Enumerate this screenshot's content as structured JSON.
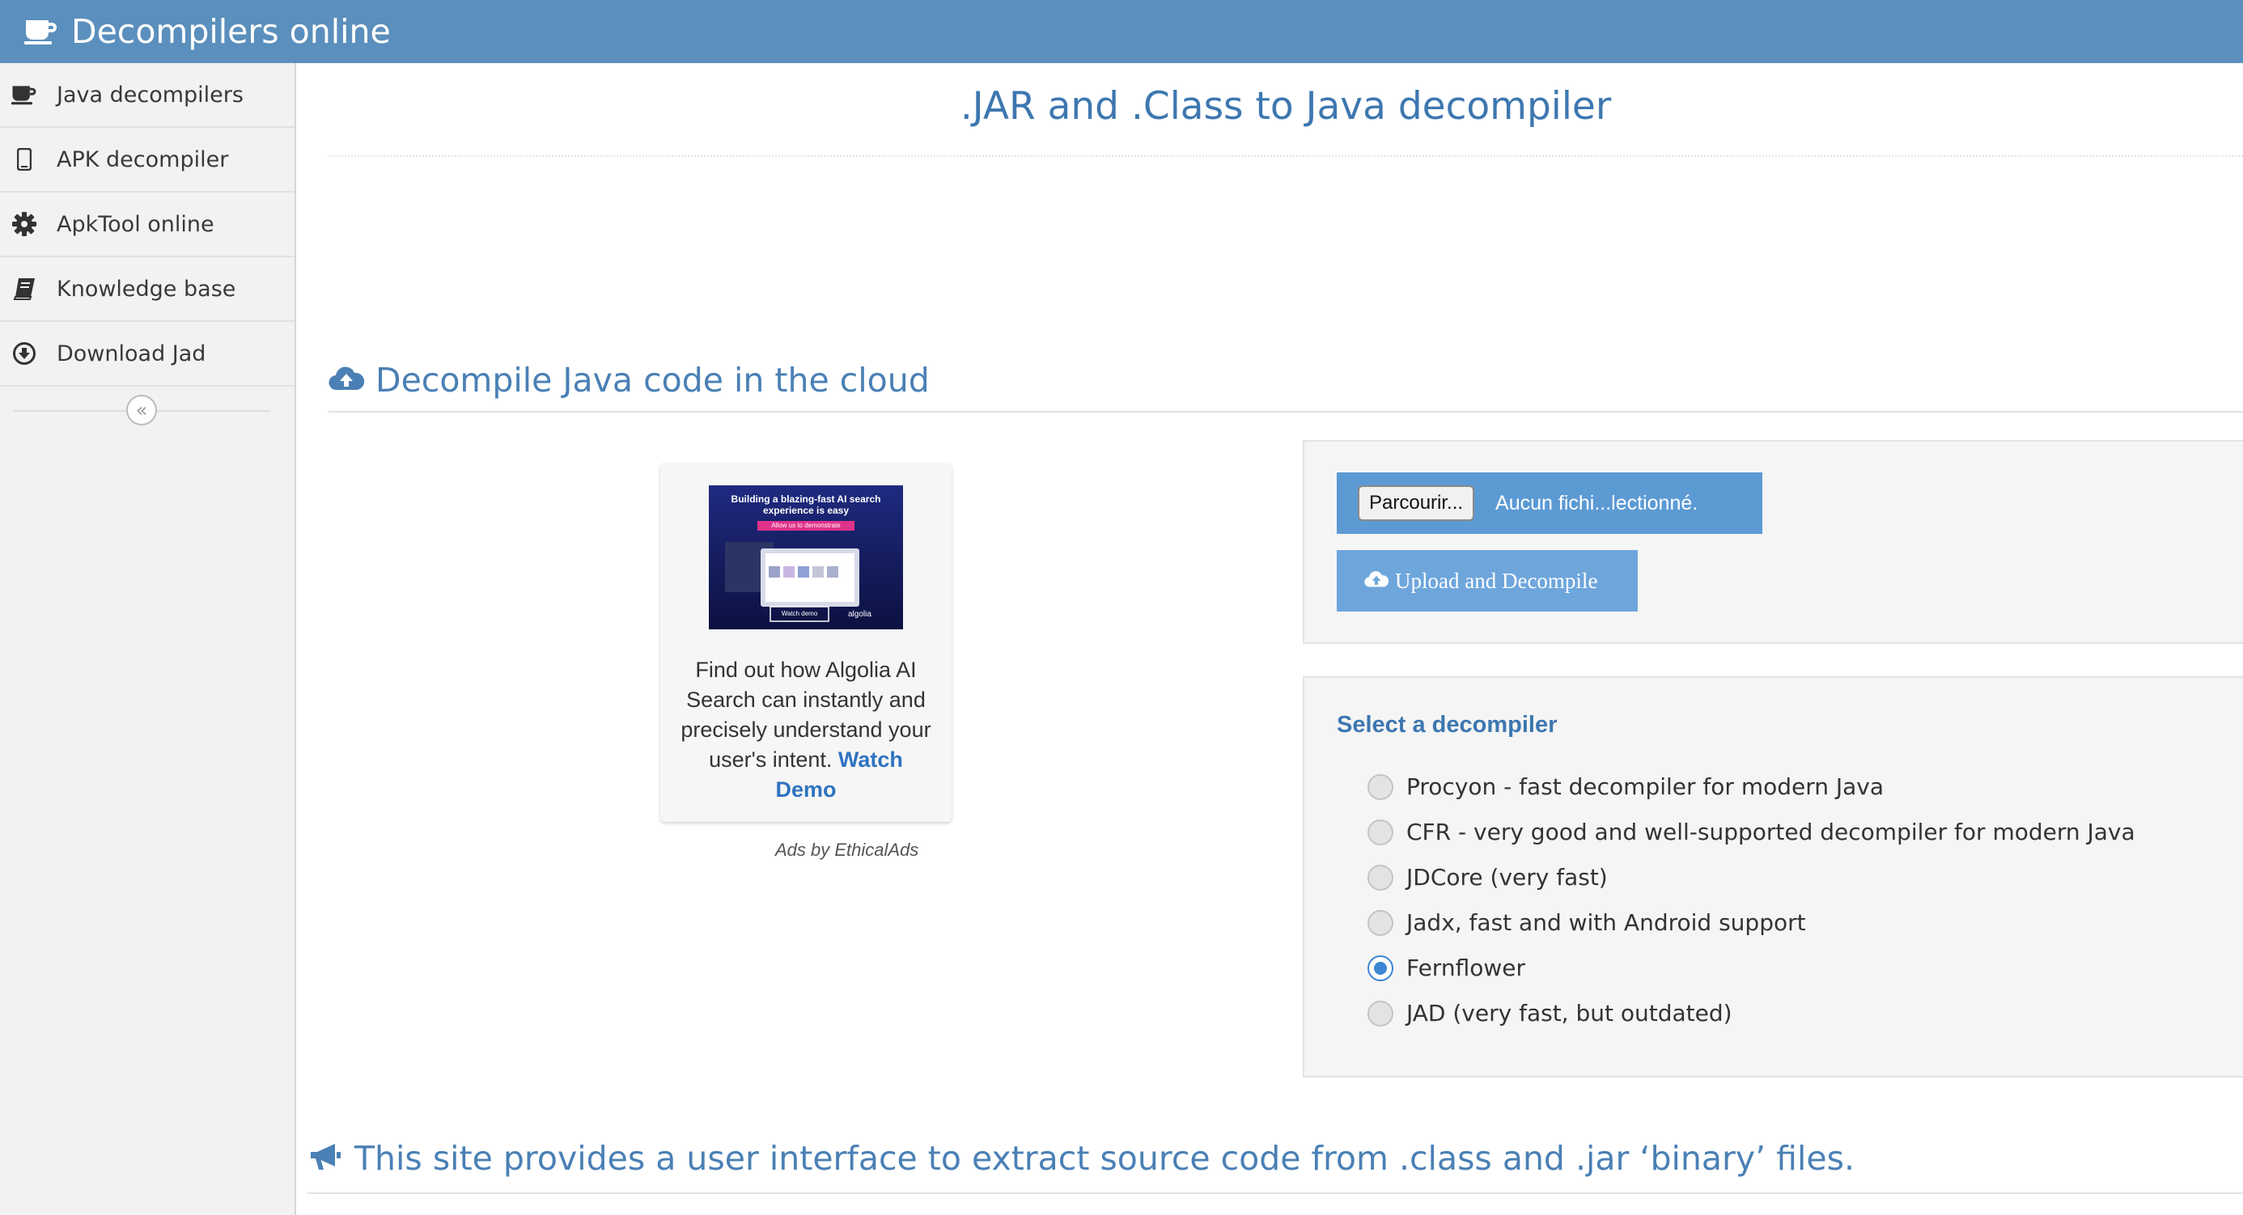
{
  "header": {
    "brand": "Decompilers online",
    "brand_icon": "coffee-cup-icon"
  },
  "sidebar": {
    "items": [
      {
        "label": "Java decompilers",
        "icon": "coffee-cup-icon"
      },
      {
        "label": "APK decompiler",
        "icon": "mobile-phone-icon"
      },
      {
        "label": "ApkTool online",
        "icon": "gear-icon"
      },
      {
        "label": "Knowledge base",
        "icon": "book-icon"
      },
      {
        "label": "Download Jad",
        "icon": "download-circle-icon"
      }
    ],
    "collapse_glyph": "«"
  },
  "main": {
    "title": ".JAR and .Class to Java decompiler",
    "section_title": "Decompile Java code in the cloud",
    "bottom_title": "This site provides a user interface to extract source code from .class and .jar ‘binary’ files."
  },
  "ad": {
    "image_headline": "Building a blazing-fast AI search experience is easy",
    "image_tagline": "Allow us to demonstrate",
    "image_button": "Watch demo",
    "image_brand": "algolia",
    "text": "Find out how Algolia AI Search can instantly and precisely understand your user's intent.",
    "link": "Watch Demo",
    "attribution": "Ads by EthicalAds"
  },
  "upload": {
    "browse_label": "Parcourir...",
    "file_status": "Aucun fichi...lectionné.",
    "submit_label": "Upload and Decompile"
  },
  "decompiler": {
    "title": "Select a decompiler",
    "options": [
      {
        "label": "Procyon - fast decompiler for modern Java",
        "selected": false
      },
      {
        "label": "CFR - very good and well-supported decompiler for modern Java",
        "selected": false
      },
      {
        "label": "JDCore (very fast)",
        "selected": false
      },
      {
        "label": "Jadx, fast and with Android support",
        "selected": false
      },
      {
        "label": "Fernflower",
        "selected": true
      },
      {
        "label": "JAD (very fast, but outdated)",
        "selected": false
      }
    ]
  },
  "colors": {
    "header_bg": "#5b8fbd",
    "accent_text": "#3d77b0",
    "file_bar": "#5c9ad4",
    "upload_button": "#6ea6dc",
    "radio_selected": "#3c86d3"
  }
}
